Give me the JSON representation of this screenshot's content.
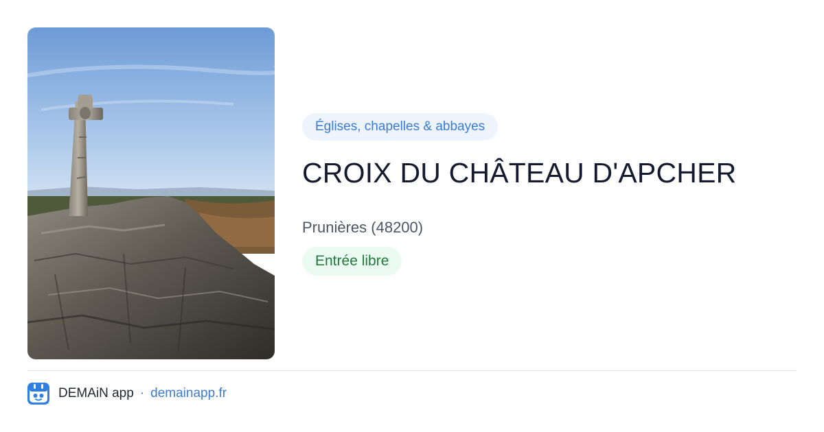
{
  "card": {
    "image_alt": "Croix du Château d'Apcher",
    "category": "Églises, chapelles & abbayes",
    "title": "CROIX DU CHÂTEAU D'APCHER",
    "location": "Prunières (48200)",
    "entry": "Entrée libre"
  },
  "footer": {
    "app_name": "DEMAiN app",
    "separator": "·",
    "url": "demainapp.fr",
    "icon": "demain-app-logo-icon"
  },
  "colors": {
    "accent": "#3b7bd4",
    "category_bg": "#eef4fd",
    "entry_text": "#1f7a3a",
    "entry_bg": "#ecfbf1",
    "title": "#151a2e",
    "location": "#4b5563",
    "divider": "#dde3e7"
  }
}
